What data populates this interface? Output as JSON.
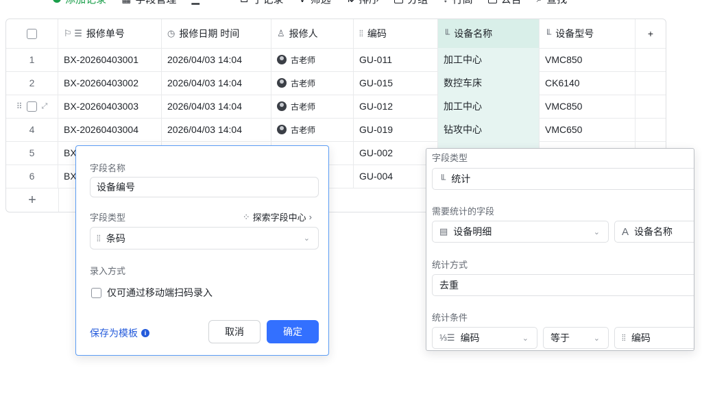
{
  "toolbar": {
    "items": [
      "添加记录",
      "字段管理",
      "子记录",
      "筛选",
      "排序",
      "分组",
      "行高",
      "公告",
      "查找"
    ]
  },
  "grid": {
    "headers": {
      "order": "报修单号",
      "date": "报修日期 时间",
      "reporter": "报修人",
      "code": "编码",
      "device_name": "设备名称",
      "device_model": "设备型号"
    },
    "rows": [
      {
        "index": "1",
        "order": "BX-20260403001",
        "date": "2026/04/03 14:04",
        "reporter": "古老师",
        "code": "GU-011",
        "device_name": "加工中心",
        "device_model": "VMC850"
      },
      {
        "index": "2",
        "order": "BX-20260403002",
        "date": "2026/04/03 14:04",
        "reporter": "古老师",
        "code": "GU-015",
        "device_name": "数控车床",
        "device_model": "CK6140"
      },
      {
        "index": "",
        "order": "BX-20260403003",
        "date": "2026/04/03 14:04",
        "reporter": "古老师",
        "code": "GU-012",
        "device_name": "加工中心",
        "device_model": "VMC850"
      },
      {
        "index": "4",
        "order": "BX-20260403004",
        "date": "2026/04/03 14:04",
        "reporter": "古老师",
        "code": "GU-019",
        "device_name": "钻攻中心",
        "device_model": "VMC650"
      },
      {
        "index": "5",
        "order": "BX",
        "code": "GU-002"
      },
      {
        "index": "6",
        "order": "BX",
        "code": "GU-004"
      }
    ],
    "add_symbol": "+"
  },
  "field_editor": {
    "name_label": "字段名称",
    "name_value": "设备编号",
    "type_label": "字段类型",
    "explore_label": "探索字段中心",
    "type_value": "条码",
    "input_mode_label": "录入方式",
    "mobile_scan_only": "仅可通过移动端扫码录入",
    "save_template": "保存为模板",
    "cancel": "取消",
    "confirm": "确定"
  },
  "stats_config": {
    "type_label": "字段类型",
    "type_value": "统计",
    "field_label": "需要统计的字段",
    "source_table": "设备明细",
    "source_field": "设备名称",
    "method_label": "统计方式",
    "method_value": "去重",
    "condition_label": "统计条件",
    "cond_field": "编码",
    "cond_op": "等于",
    "cond_value": "编码"
  },
  "colors": {
    "primary": "#3370ff",
    "link": "#245bdb",
    "green": "#1a9e4a",
    "highlight_col": "#e6f4f1"
  }
}
